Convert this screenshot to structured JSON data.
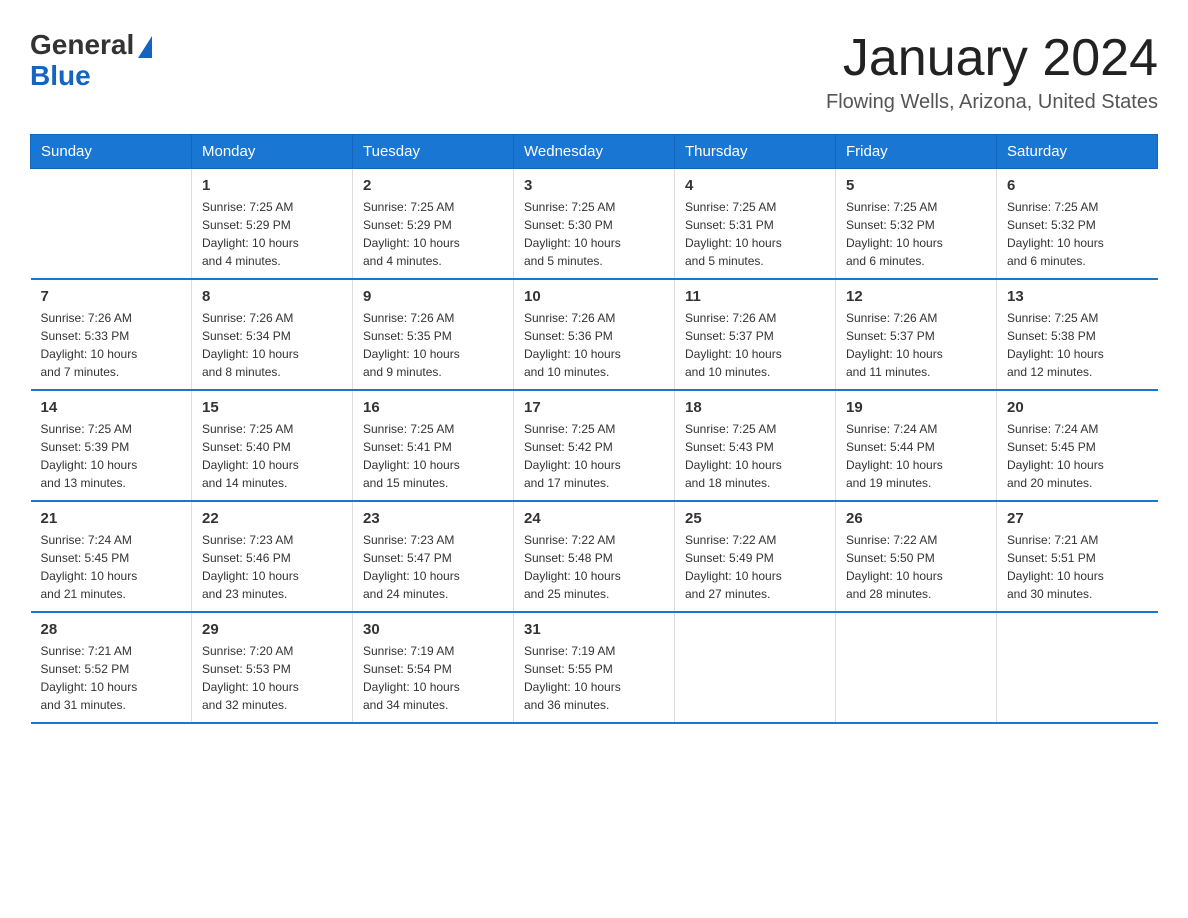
{
  "header": {
    "logo_general": "General",
    "logo_blue": "Blue",
    "month_title": "January 2024",
    "location": "Flowing Wells, Arizona, United States"
  },
  "days_of_week": [
    "Sunday",
    "Monday",
    "Tuesday",
    "Wednesday",
    "Thursday",
    "Friday",
    "Saturday"
  ],
  "weeks": [
    [
      {
        "day": "",
        "info": ""
      },
      {
        "day": "1",
        "info": "Sunrise: 7:25 AM\nSunset: 5:29 PM\nDaylight: 10 hours\nand 4 minutes."
      },
      {
        "day": "2",
        "info": "Sunrise: 7:25 AM\nSunset: 5:29 PM\nDaylight: 10 hours\nand 4 minutes."
      },
      {
        "day": "3",
        "info": "Sunrise: 7:25 AM\nSunset: 5:30 PM\nDaylight: 10 hours\nand 5 minutes."
      },
      {
        "day": "4",
        "info": "Sunrise: 7:25 AM\nSunset: 5:31 PM\nDaylight: 10 hours\nand 5 minutes."
      },
      {
        "day": "5",
        "info": "Sunrise: 7:25 AM\nSunset: 5:32 PM\nDaylight: 10 hours\nand 6 minutes."
      },
      {
        "day": "6",
        "info": "Sunrise: 7:25 AM\nSunset: 5:32 PM\nDaylight: 10 hours\nand 6 minutes."
      }
    ],
    [
      {
        "day": "7",
        "info": "Sunrise: 7:26 AM\nSunset: 5:33 PM\nDaylight: 10 hours\nand 7 minutes."
      },
      {
        "day": "8",
        "info": "Sunrise: 7:26 AM\nSunset: 5:34 PM\nDaylight: 10 hours\nand 8 minutes."
      },
      {
        "day": "9",
        "info": "Sunrise: 7:26 AM\nSunset: 5:35 PM\nDaylight: 10 hours\nand 9 minutes."
      },
      {
        "day": "10",
        "info": "Sunrise: 7:26 AM\nSunset: 5:36 PM\nDaylight: 10 hours\nand 10 minutes."
      },
      {
        "day": "11",
        "info": "Sunrise: 7:26 AM\nSunset: 5:37 PM\nDaylight: 10 hours\nand 10 minutes."
      },
      {
        "day": "12",
        "info": "Sunrise: 7:26 AM\nSunset: 5:37 PM\nDaylight: 10 hours\nand 11 minutes."
      },
      {
        "day": "13",
        "info": "Sunrise: 7:25 AM\nSunset: 5:38 PM\nDaylight: 10 hours\nand 12 minutes."
      }
    ],
    [
      {
        "day": "14",
        "info": "Sunrise: 7:25 AM\nSunset: 5:39 PM\nDaylight: 10 hours\nand 13 minutes."
      },
      {
        "day": "15",
        "info": "Sunrise: 7:25 AM\nSunset: 5:40 PM\nDaylight: 10 hours\nand 14 minutes."
      },
      {
        "day": "16",
        "info": "Sunrise: 7:25 AM\nSunset: 5:41 PM\nDaylight: 10 hours\nand 15 minutes."
      },
      {
        "day": "17",
        "info": "Sunrise: 7:25 AM\nSunset: 5:42 PM\nDaylight: 10 hours\nand 17 minutes."
      },
      {
        "day": "18",
        "info": "Sunrise: 7:25 AM\nSunset: 5:43 PM\nDaylight: 10 hours\nand 18 minutes."
      },
      {
        "day": "19",
        "info": "Sunrise: 7:24 AM\nSunset: 5:44 PM\nDaylight: 10 hours\nand 19 minutes."
      },
      {
        "day": "20",
        "info": "Sunrise: 7:24 AM\nSunset: 5:45 PM\nDaylight: 10 hours\nand 20 minutes."
      }
    ],
    [
      {
        "day": "21",
        "info": "Sunrise: 7:24 AM\nSunset: 5:45 PM\nDaylight: 10 hours\nand 21 minutes."
      },
      {
        "day": "22",
        "info": "Sunrise: 7:23 AM\nSunset: 5:46 PM\nDaylight: 10 hours\nand 23 minutes."
      },
      {
        "day": "23",
        "info": "Sunrise: 7:23 AM\nSunset: 5:47 PM\nDaylight: 10 hours\nand 24 minutes."
      },
      {
        "day": "24",
        "info": "Sunrise: 7:22 AM\nSunset: 5:48 PM\nDaylight: 10 hours\nand 25 minutes."
      },
      {
        "day": "25",
        "info": "Sunrise: 7:22 AM\nSunset: 5:49 PM\nDaylight: 10 hours\nand 27 minutes."
      },
      {
        "day": "26",
        "info": "Sunrise: 7:22 AM\nSunset: 5:50 PM\nDaylight: 10 hours\nand 28 minutes."
      },
      {
        "day": "27",
        "info": "Sunrise: 7:21 AM\nSunset: 5:51 PM\nDaylight: 10 hours\nand 30 minutes."
      }
    ],
    [
      {
        "day": "28",
        "info": "Sunrise: 7:21 AM\nSunset: 5:52 PM\nDaylight: 10 hours\nand 31 minutes."
      },
      {
        "day": "29",
        "info": "Sunrise: 7:20 AM\nSunset: 5:53 PM\nDaylight: 10 hours\nand 32 minutes."
      },
      {
        "day": "30",
        "info": "Sunrise: 7:19 AM\nSunset: 5:54 PM\nDaylight: 10 hours\nand 34 minutes."
      },
      {
        "day": "31",
        "info": "Sunrise: 7:19 AM\nSunset: 5:55 PM\nDaylight: 10 hours\nand 36 minutes."
      },
      {
        "day": "",
        "info": ""
      },
      {
        "day": "",
        "info": ""
      },
      {
        "day": "",
        "info": ""
      }
    ]
  ]
}
